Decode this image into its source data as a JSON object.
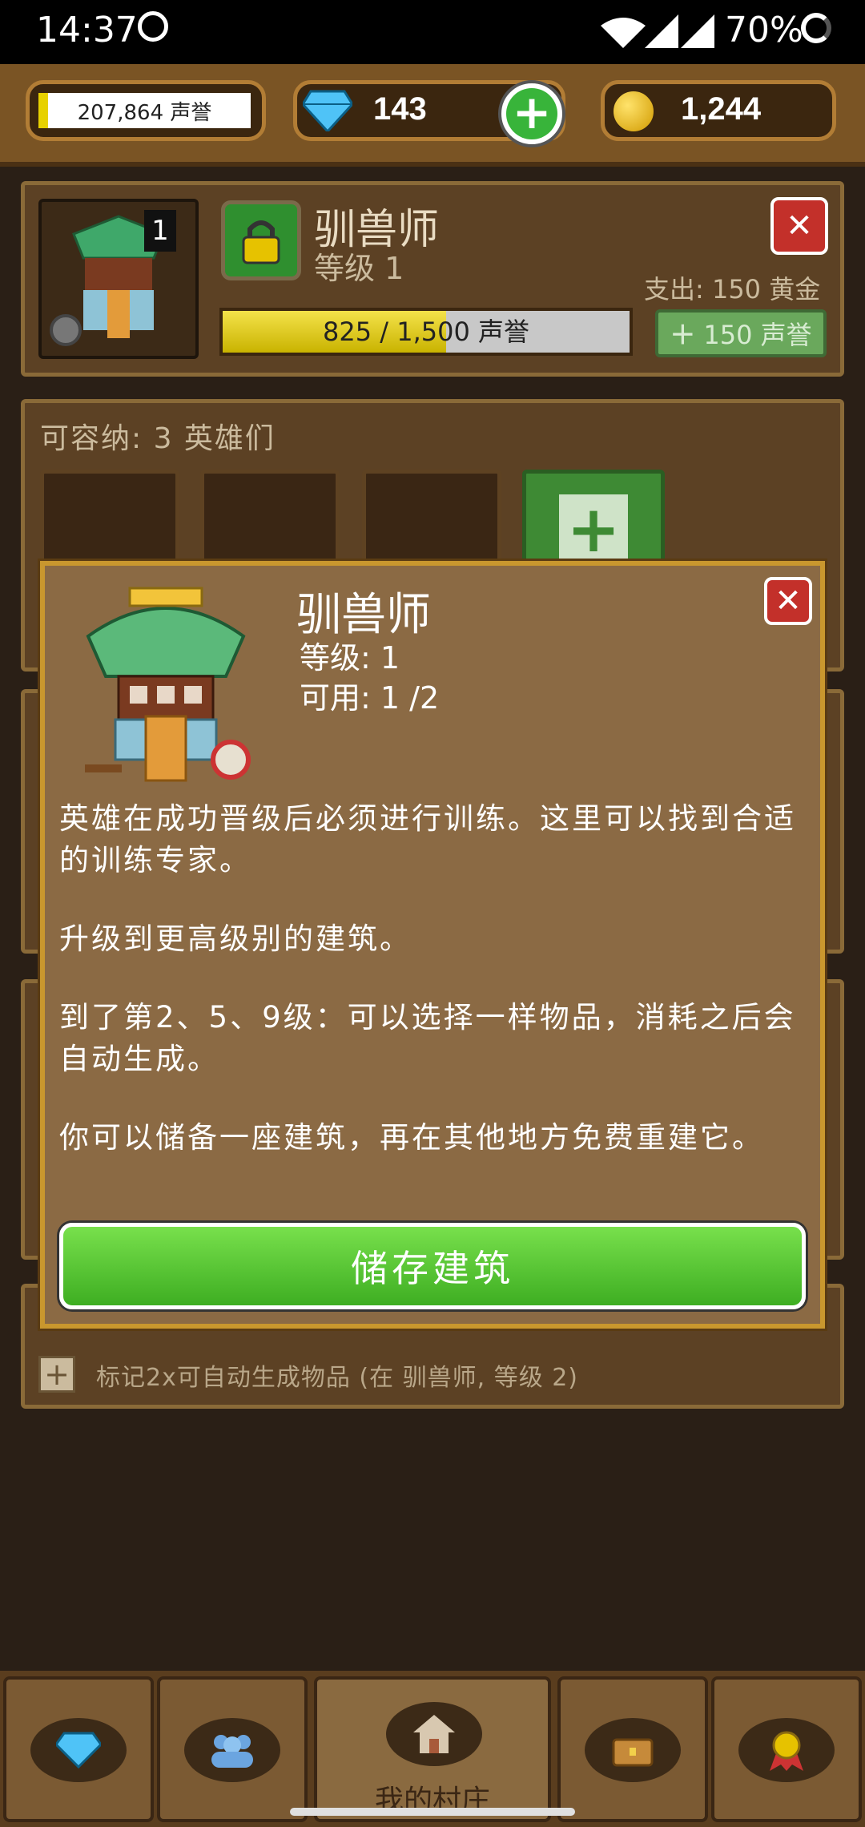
{
  "status_bar": {
    "time": "14:37",
    "battery": "70%"
  },
  "currency": {
    "fame": "207,864 声誉",
    "gems": "143",
    "gold": "1,244"
  },
  "building": {
    "name": "驯兽师",
    "level": "等级 1",
    "badge": "1",
    "cost": "支出: 150 黄金",
    "progress_text": "825 / 1,500 声誉",
    "progress_fraction": 0.55,
    "upgrade_label": "150 声誉"
  },
  "capacity": {
    "label": "可容纳: 3 英雄们"
  },
  "modal": {
    "title": "驯兽师",
    "level": "等级: 1",
    "available": "可用: 1 /2",
    "paragraphs": [
      "英雄在成功晋级后必须进行训练。这里可以找到合适的训练专家。",
      "升级到更高级别的建筑。",
      "到了第2、5、9级：可以选择一样物品，消耗之后会自动生成。",
      "你可以储备一座建筑，再在其他地方免费重建它。"
    ],
    "store_button": "储存建筑"
  },
  "note": {
    "text": "标记2x可自动生成物品 (在 驯兽师, 等级 2)"
  },
  "nav": {
    "village_label": "我的村庄"
  },
  "colors": {
    "accent_green": "#3eae22",
    "panel_brown": "#5c4124",
    "gold_border": "#c9972e",
    "close_red": "#c3302a"
  }
}
